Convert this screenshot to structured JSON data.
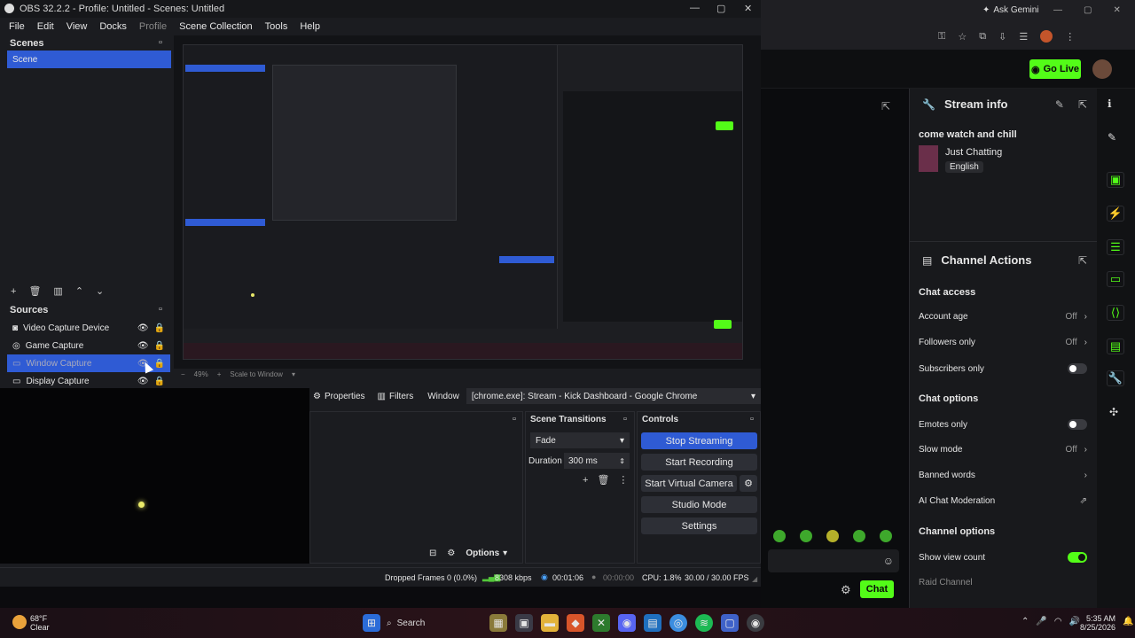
{
  "obs": {
    "title": "OBS 32.2.2 - Profile: Untitled - Scenes: Untitled",
    "menu": [
      "File",
      "Edit",
      "View",
      "Docks",
      "Profile",
      "Scene Collection",
      "Tools",
      "Help"
    ],
    "scenes_title": "Scenes",
    "scenes": [
      "Scene"
    ],
    "sources_title": "Sources",
    "sources": [
      {
        "label": "Video Capture Device",
        "icon": "camera-icon"
      },
      {
        "label": "Game Capture",
        "icon": "gamepad-icon"
      },
      {
        "label": "Window Capture",
        "icon": "window-icon"
      },
      {
        "label": "Display Capture",
        "icon": "monitor-icon"
      }
    ],
    "properties_label": "Properties",
    "filters_label": "Filters",
    "window_label": "Window",
    "window_value": "[chrome.exe]: Stream - Kick Dashboard - Google Chrome",
    "scene_transitions_title": "Scene Transitions",
    "transition_value": "Fade",
    "duration_label": "Duration",
    "duration_value": "300 ms",
    "controls_title": "Controls",
    "controls": [
      "Stop Streaming",
      "Start Recording",
      "Start Virtual Camera",
      "Studio Mode",
      "Settings"
    ],
    "options_label": "Options",
    "zoom_label": "49%",
    "scale_label": "Scale to Window",
    "status": {
      "dropped": "Dropped Frames 0 (0.0%)",
      "bitrate": "8308 kbps",
      "stream_time": "00:01:06",
      "rec_time": "00:00:00",
      "cpu": "CPU: 1.8%",
      "fps": "30.00 / 30.00 FPS"
    }
  },
  "chrome": {
    "ask_gemini": "Ask Gemini"
  },
  "kick": {
    "go_live": "Go Live",
    "stream_info_title": "Stream info",
    "stream_title": "come watch and chill",
    "category": "Just Chatting",
    "language": "English",
    "channel_actions_title": "Channel Actions",
    "chat_access_title": "Chat access",
    "account_age": "Account age",
    "account_age_value": "Off",
    "followers_only": "Followers only",
    "followers_only_value": "Off",
    "subscribers_only": "Subscribers only",
    "chat_options_title": "Chat options",
    "emotes_only": "Emotes only",
    "slow_mode": "Slow mode",
    "slow_mode_value": "Off",
    "banned_words": "Banned words",
    "ai_moderation": "AI Chat Moderation",
    "channel_options_title": "Channel options",
    "show_view_count": "Show view count",
    "raid_channel": "Raid Channel",
    "chat_button": "Chat"
  },
  "taskbar": {
    "weather_temp": "68°F",
    "weather_desc": "Clear",
    "search": "Search",
    "time": "5:35 AM",
    "date": "8/25/2026"
  },
  "colors": {
    "accent_blue": "#2f5bd4",
    "kick_green": "#53fc18"
  }
}
